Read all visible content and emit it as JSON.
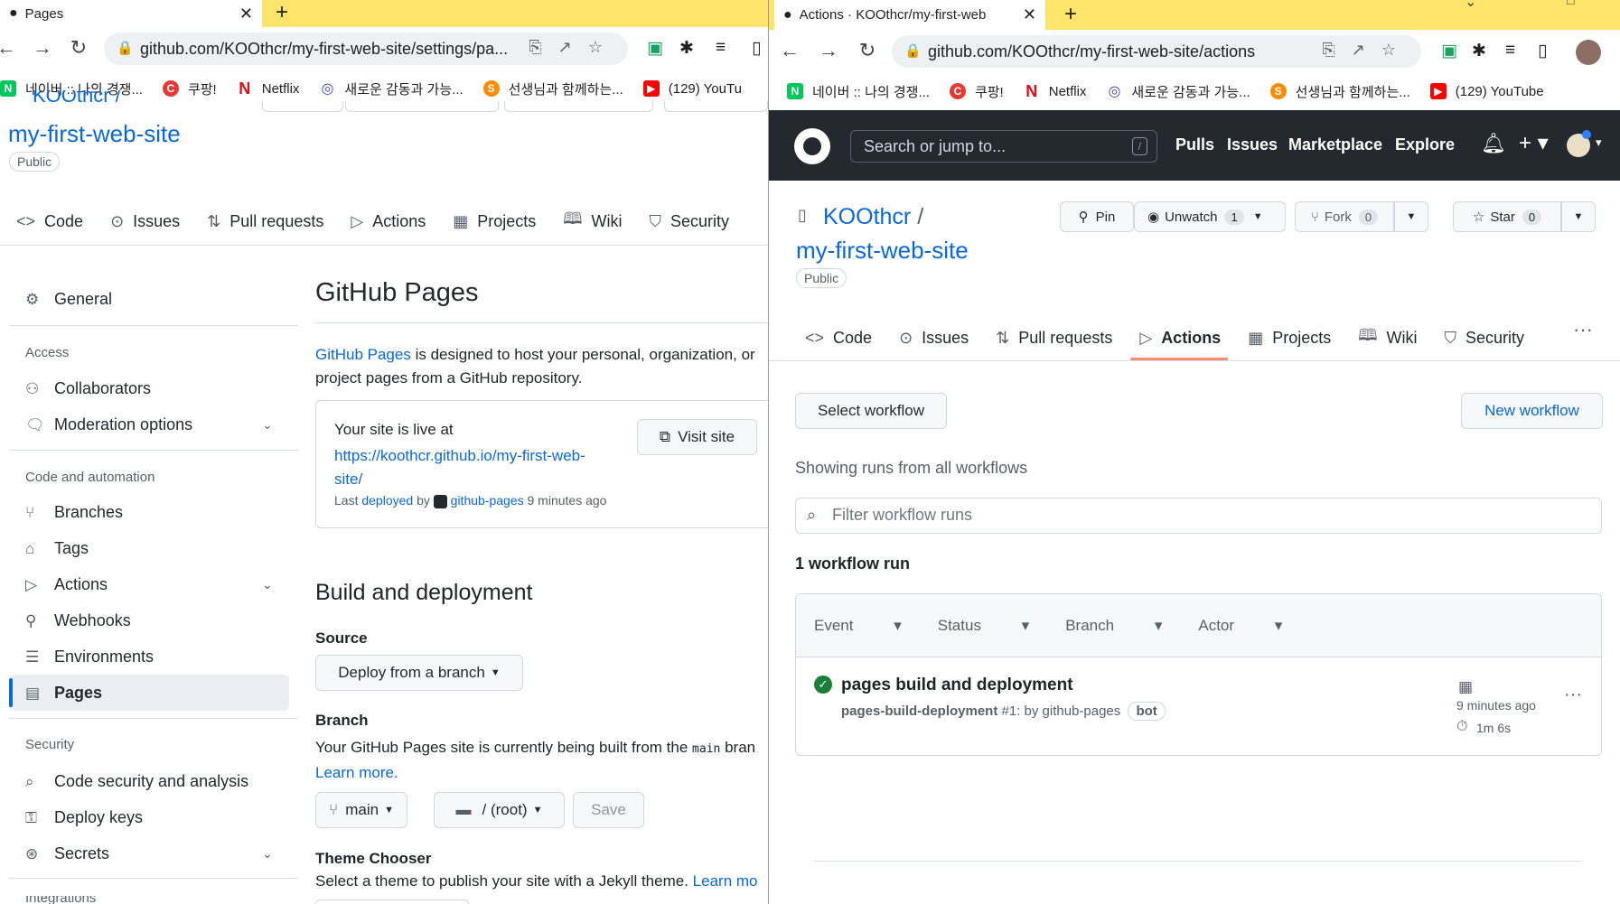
{
  "left": {
    "tab_title": "Pages",
    "url": "github.com/KOOthcr/my-first-web-site/settings/pa...",
    "bookmarks": [
      "네이버 :: 나의 경쟁...",
      "쿠팡!",
      "Netflix",
      "새로운 감동과 가능...",
      "선생님과 함께하는...",
      "(129) YouTu"
    ],
    "owner_partial": "KOOthcr /",
    "repo_name": "my-first-web-site",
    "visibility": "Public",
    "nav": [
      "Code",
      "Issues",
      "Pull requests",
      "Actions",
      "Projects",
      "Wiki",
      "Security"
    ],
    "sidebar": {
      "general": "General",
      "access_head": "Access",
      "collaborators": "Collaborators",
      "moderation": "Moderation options",
      "code_head": "Code and automation",
      "branches": "Branches",
      "tags": "Tags",
      "actions": "Actions",
      "webhooks": "Webhooks",
      "environments": "Environments",
      "pages": "Pages",
      "security_head": "Security",
      "code_security": "Code security and analysis",
      "deploy_keys": "Deploy keys",
      "secrets": "Secrets",
      "integrations_partial": "Integrations"
    },
    "pages": {
      "title": "GitHub Pages",
      "desc_link": "GitHub Pages",
      "desc_rest1": " is designed to host your personal, organization, or",
      "desc_rest2": "project pages from a GitHub repository.",
      "live_label": "Your site is live at",
      "live_url1": "https://koothcr.github.io/my-first-web-",
      "live_url2": "site/",
      "visit": "Visit site",
      "last": "Last",
      "deployed": "deployed",
      "by": "by",
      "bot": "github-pages",
      "ago": "9 minutes ago",
      "build_title": "Build and deployment",
      "source_label": "Source",
      "source_value": "Deploy from a branch",
      "branch_label": "Branch",
      "branch_desc": "Your GitHub Pages site is currently being built from the",
      "branch_code": "main",
      "branch_desc2": "bran",
      "learn_more": "Learn more.",
      "branch_value": "main",
      "folder_value": "/ (root)",
      "save": "Save",
      "theme_label": "Theme Chooser",
      "theme_desc": "Select a theme to publish your site with a Jekyll theme.",
      "theme_learn": "Learn mo"
    }
  },
  "right": {
    "tab_title": "Actions · KOOthcr/my-first-web",
    "url": "github.com/KOOthcr/my-first-web-site/actions",
    "bookmarks": [
      "네이버 :: 나의 경쟁...",
      "쿠팡!",
      "Netflix",
      "새로운 감동과 가능...",
      "선생님과 함께하는...",
      "(129) YouTube"
    ],
    "search_placeholder": "Search or jump to...",
    "search_key": "/",
    "header_nav": [
      "Pulls",
      "Issues",
      "Marketplace",
      "Explore"
    ],
    "owner": "KOOthcr",
    "repo_name": "my-first-web-site",
    "visibility": "Public",
    "pin": "Pin",
    "unwatch": "Unwatch",
    "unwatch_count": "1",
    "fork": "Fork",
    "fork_count": "0",
    "star": "Star",
    "star_count": "0",
    "nav": [
      "Code",
      "Issues",
      "Pull requests",
      "Actions",
      "Projects",
      "Wiki",
      "Security"
    ],
    "select_workflow": "Select workflow",
    "new_workflow": "New workflow",
    "showing": "Showing runs from all workflows",
    "filter_placeholder": "Filter workflow runs",
    "run_count": "1 workflow run",
    "filters": [
      "Event",
      "Status",
      "Branch",
      "Actor"
    ],
    "run": {
      "title": "pages build and deployment",
      "workflow": "pages-build-deployment",
      "meta": " #1: by github-pages",
      "bot": "bot",
      "time": "9 minutes ago",
      "duration": "1m 6s"
    },
    "accent": "#fd8c73",
    "success": "#1a7f37"
  }
}
